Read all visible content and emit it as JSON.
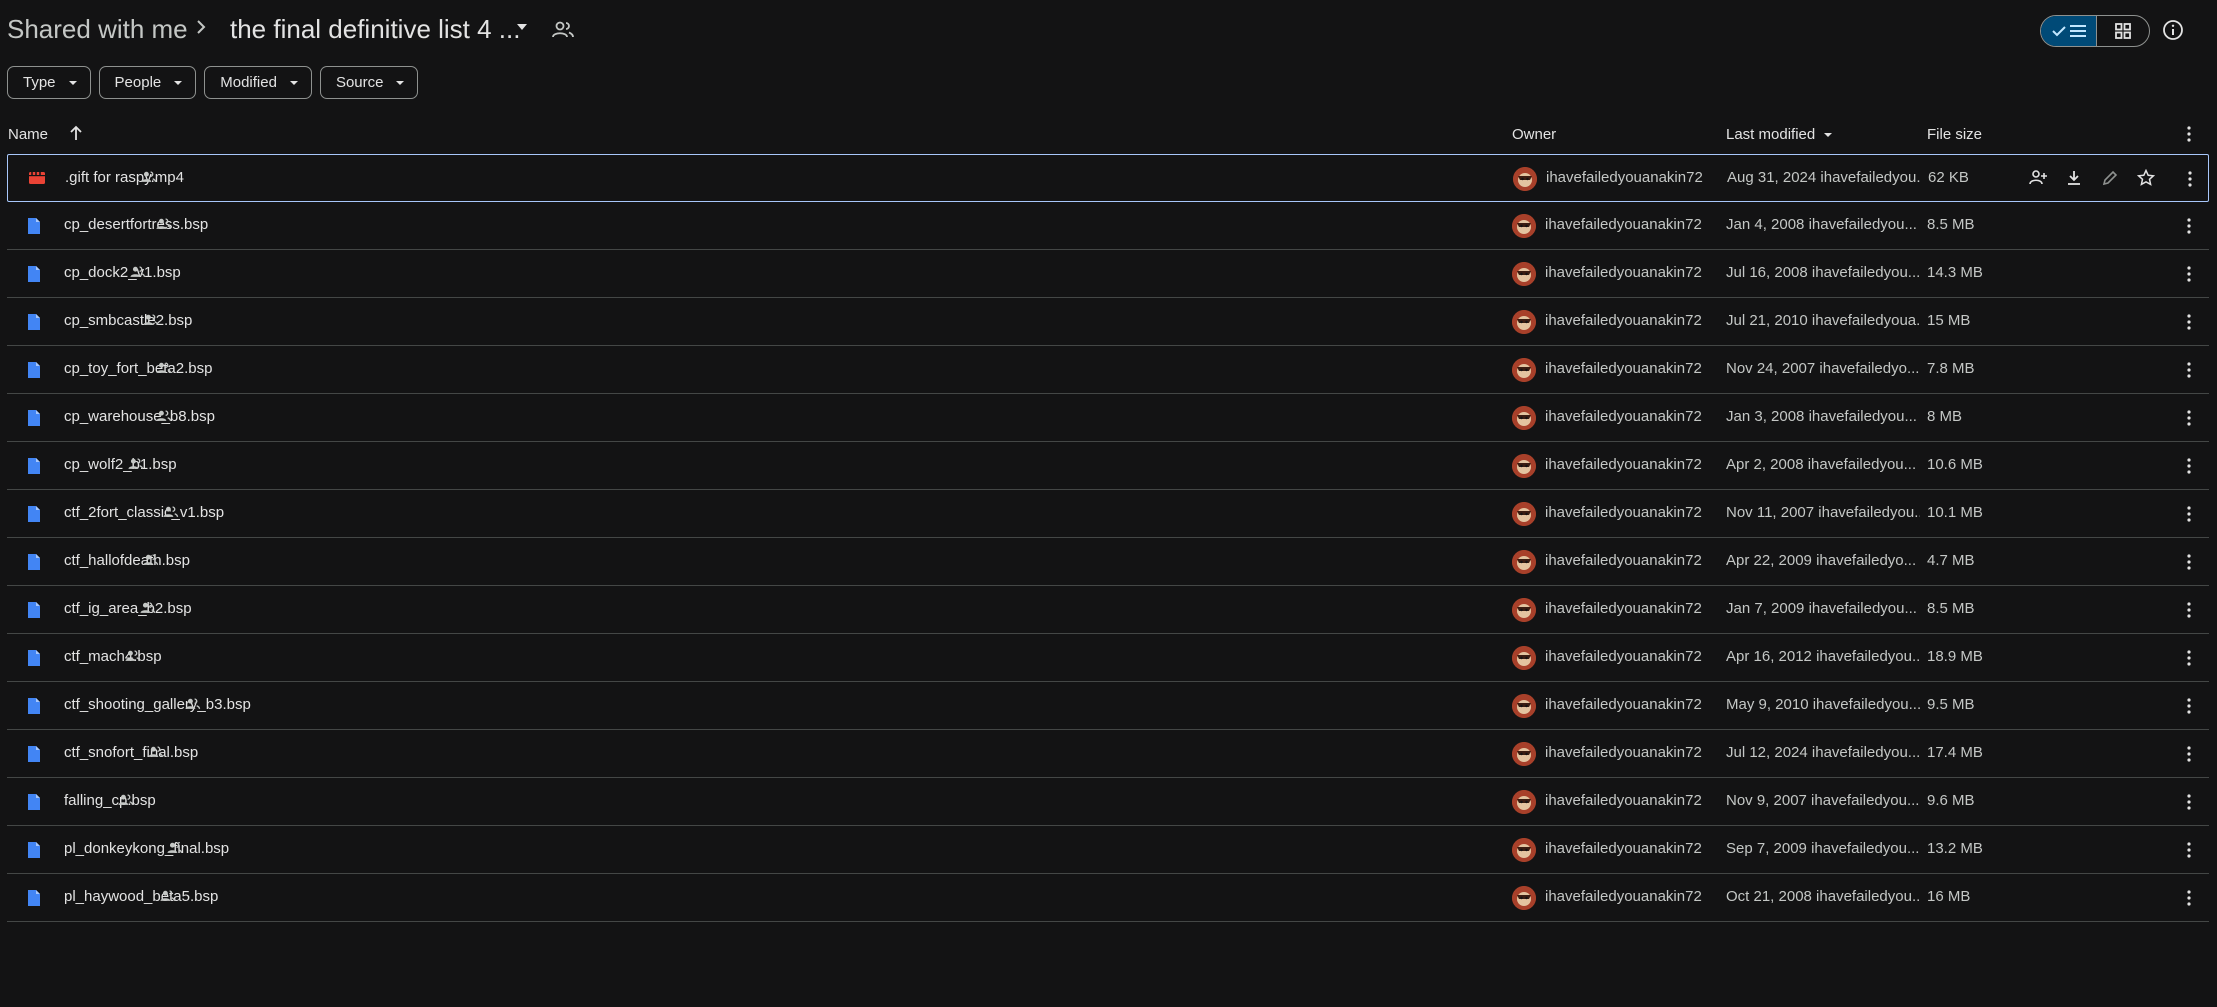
{
  "breadcrumb": {
    "root": "Shared with me",
    "current": "the final definitive list 4 ..."
  },
  "view_toggle": {
    "list_icon": "check-list-icon",
    "grid_icon": "grid-icon"
  },
  "filters": [
    "Type",
    "People",
    "Modified",
    "Source"
  ],
  "columns": {
    "name": "Name",
    "owner": "Owner",
    "last_modified": "Last modified",
    "file_size": "File size"
  },
  "colors": {
    "accent": "#a8c7fa",
    "selected_toggle": "#004a77",
    "doc_icon": "#4285f4",
    "video_icon": "#ea4335"
  },
  "files": [
    {
      "name": ".gift for raspy.mp4",
      "type": "video",
      "owner": "ihavefailedyouanakin72",
      "modified": "Aug 31, 2024 ihavefailedyou...",
      "size": "62 KB"
    },
    {
      "name": "cp_desertfortress.bsp",
      "type": "doc",
      "owner": "ihavefailedyouanakin72",
      "modified": "Jan 4, 2008 ihavefailedyou...",
      "size": "8.5 MB"
    },
    {
      "name": "cp_dock2_v1.bsp",
      "type": "doc",
      "owner": "ihavefailedyouanakin72",
      "modified": "Jul 16, 2008 ihavefailedyou...",
      "size": "14.3 MB"
    },
    {
      "name": "cp_smbcastle2.bsp",
      "type": "doc",
      "owner": "ihavefailedyouanakin72",
      "modified": "Jul 21, 2010 ihavefailedyoua...",
      "size": "15 MB"
    },
    {
      "name": "cp_toy_fort_beta2.bsp",
      "type": "doc",
      "owner": "ihavefailedyouanakin72",
      "modified": "Nov 24, 2007 ihavefailedyo...",
      "size": "7.8 MB"
    },
    {
      "name": "cp_warehouse_b8.bsp",
      "type": "doc",
      "owner": "ihavefailedyouanakin72",
      "modified": "Jan 3, 2008 ihavefailedyou...",
      "size": "8 MB"
    },
    {
      "name": "cp_wolf2_b1.bsp",
      "type": "doc",
      "owner": "ihavefailedyouanakin72",
      "modified": "Apr 2, 2008 ihavefailedyou...",
      "size": "10.6 MB"
    },
    {
      "name": "ctf_2fort_classic_v1.bsp",
      "type": "doc",
      "owner": "ihavefailedyouanakin72",
      "modified": "Nov 11, 2007 ihavefailedyou...",
      "size": "10.1 MB"
    },
    {
      "name": "ctf_hallofdeath.bsp",
      "type": "doc",
      "owner": "ihavefailedyouanakin72",
      "modified": "Apr 22, 2009 ihavefailedyo...",
      "size": "4.7 MB"
    },
    {
      "name": "ctf_ig_area_b2.bsp",
      "type": "doc",
      "owner": "ihavefailedyouanakin72",
      "modified": "Jan 7, 2009 ihavefailedyou...",
      "size": "8.5 MB"
    },
    {
      "name": "ctf_mach4.bsp",
      "type": "doc",
      "owner": "ihavefailedyouanakin72",
      "modified": "Apr 16, 2012 ihavefailedyou...",
      "size": "18.9 MB"
    },
    {
      "name": "ctf_shooting_gallery_b3.bsp",
      "type": "doc",
      "owner": "ihavefailedyouanakin72",
      "modified": "May 9, 2010 ihavefailedyou...",
      "size": "9.5 MB"
    },
    {
      "name": "ctf_snofort_final.bsp",
      "type": "doc",
      "owner": "ihavefailedyouanakin72",
      "modified": "Jul 12, 2024 ihavefailedyou...",
      "size": "17.4 MB"
    },
    {
      "name": "falling_cp.bsp",
      "type": "doc",
      "owner": "ihavefailedyouanakin72",
      "modified": "Nov 9, 2007 ihavefailedyou...",
      "size": "9.6 MB"
    },
    {
      "name": "pl_donkeykong_final.bsp",
      "type": "doc",
      "owner": "ihavefailedyouanakin72",
      "modified": "Sep 7, 2009 ihavefailedyou...",
      "size": "13.2 MB"
    },
    {
      "name": "pl_haywood_beta5.bsp",
      "type": "doc",
      "owner": "ihavefailedyouanakin72",
      "modified": "Oct 21, 2008 ihavefailedyou...",
      "size": "16 MB"
    }
  ]
}
